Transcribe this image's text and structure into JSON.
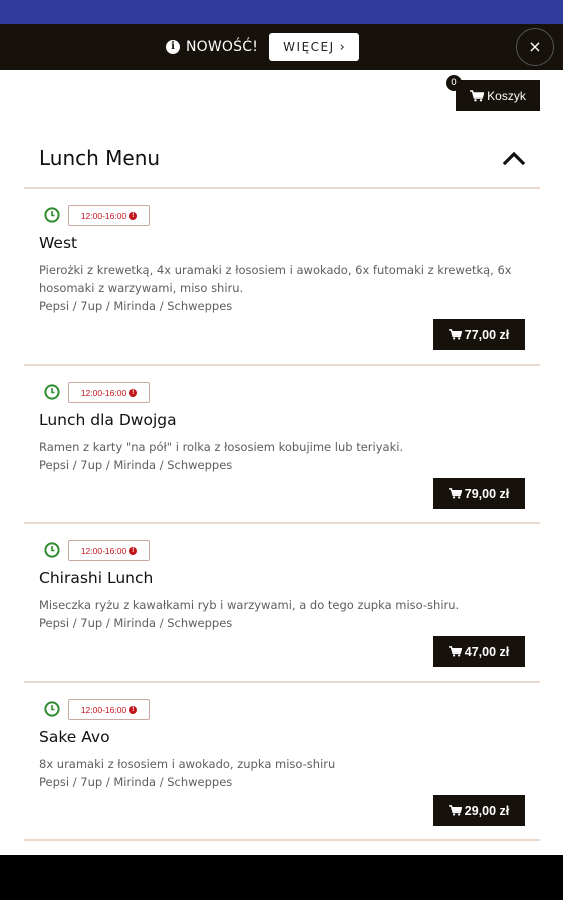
{
  "notice": {
    "text": "NOWOŚĆ!",
    "more_label": "WIĘCEJ",
    "close_label": "×"
  },
  "cart": {
    "count": "0",
    "label": "Koszyk"
  },
  "section": {
    "title": "Lunch Menu"
  },
  "items": [
    {
      "time": "12:00-16:00",
      "name": "West",
      "desc": "Pierożki z krewetką, 4x uramaki z łososiem i awokado, 6x futomaki z krewetką, 6x hosomaki z warzywami, miso shiru.",
      "drinks": "Pepsi / 7up / Mirinda / Schweppes",
      "price": "77,00 zł"
    },
    {
      "time": "12:00-16:00",
      "name": "Lunch dla Dwojga",
      "desc": "Ramen z karty \"na pół\" i rolka z łososiem kobujime lub teriyaki.",
      "drinks": "Pepsi / 7up / Mirinda / Schweppes",
      "price": "79,00 zł"
    },
    {
      "time": "12:00-16:00",
      "name": "Chirashi Lunch",
      "desc": "Miseczka ryżu z kawałkami ryb i warzywami, a do tego zupka miso-shiru.",
      "drinks": "Pepsi / 7up / Mirinda / Schweppes",
      "price": "47,00 zł"
    },
    {
      "time": "12:00-16:00",
      "name": "Sake Avo",
      "desc": "8x uramaki z łososiem i awokado, zupka miso-shiru",
      "drinks": "Pepsi / 7up / Mirinda / Schweppes",
      "price": "29,00 zł"
    }
  ],
  "colors": {
    "status_bar": "#2e3a9c",
    "dark": "#16110b",
    "time_red": "#c0161c",
    "clock_green": "#2e8b2e",
    "divider": "#ead9cf"
  },
  "icons": {
    "info": "info-icon",
    "cart": "cart-icon",
    "collapse": "chevron-up-icon",
    "clock": "clock-icon",
    "alert": "exclamation-icon",
    "close": "close-icon"
  }
}
